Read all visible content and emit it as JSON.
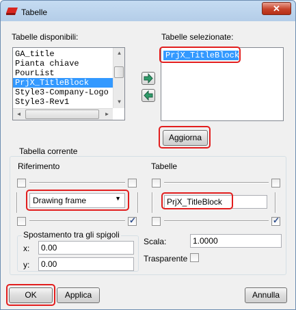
{
  "window": {
    "title": "Tabelle",
    "close_glyph": "✕"
  },
  "available": {
    "label": "Tabelle disponibili:",
    "items": [
      "GA_title",
      "Pianta chiave",
      "PourList",
      "PrjX_TitleBlock",
      "Style3-Company-Logo",
      "Style3-Rev1"
    ],
    "selected_index": 3
  },
  "selected": {
    "label": "Tabelle selezionate:",
    "items": [
      "PrjX_TitleBlock"
    ]
  },
  "buttons": {
    "move_right_icon": "arrow-right-icon",
    "move_left_icon": "arrow-left-icon",
    "update": "Aggiorna",
    "ok": "OK",
    "apply": "Applica",
    "cancel": "Annulla"
  },
  "current_table": {
    "group_title": "Tabella corrente",
    "reference_label": "Riferimento",
    "reference_value": "Drawing frame",
    "tables_label": "Tabelle",
    "table_name": "PrjX_TitleBlock",
    "offset_group_title": "Spostamento tra gli spigoli",
    "x_label": "x:",
    "x_value": "0.00",
    "y_label": "y:",
    "y_value": "0.00",
    "scale_label": "Scala:",
    "scale_value": "1.0000",
    "transparent_label": "Trasparente",
    "transparent_checked": false,
    "left_anchor_bottom_right_checked": true,
    "right_anchor_bottom_right_checked": true
  },
  "colors": {
    "highlight": "#e21d1d",
    "selection": "#3399ff"
  }
}
